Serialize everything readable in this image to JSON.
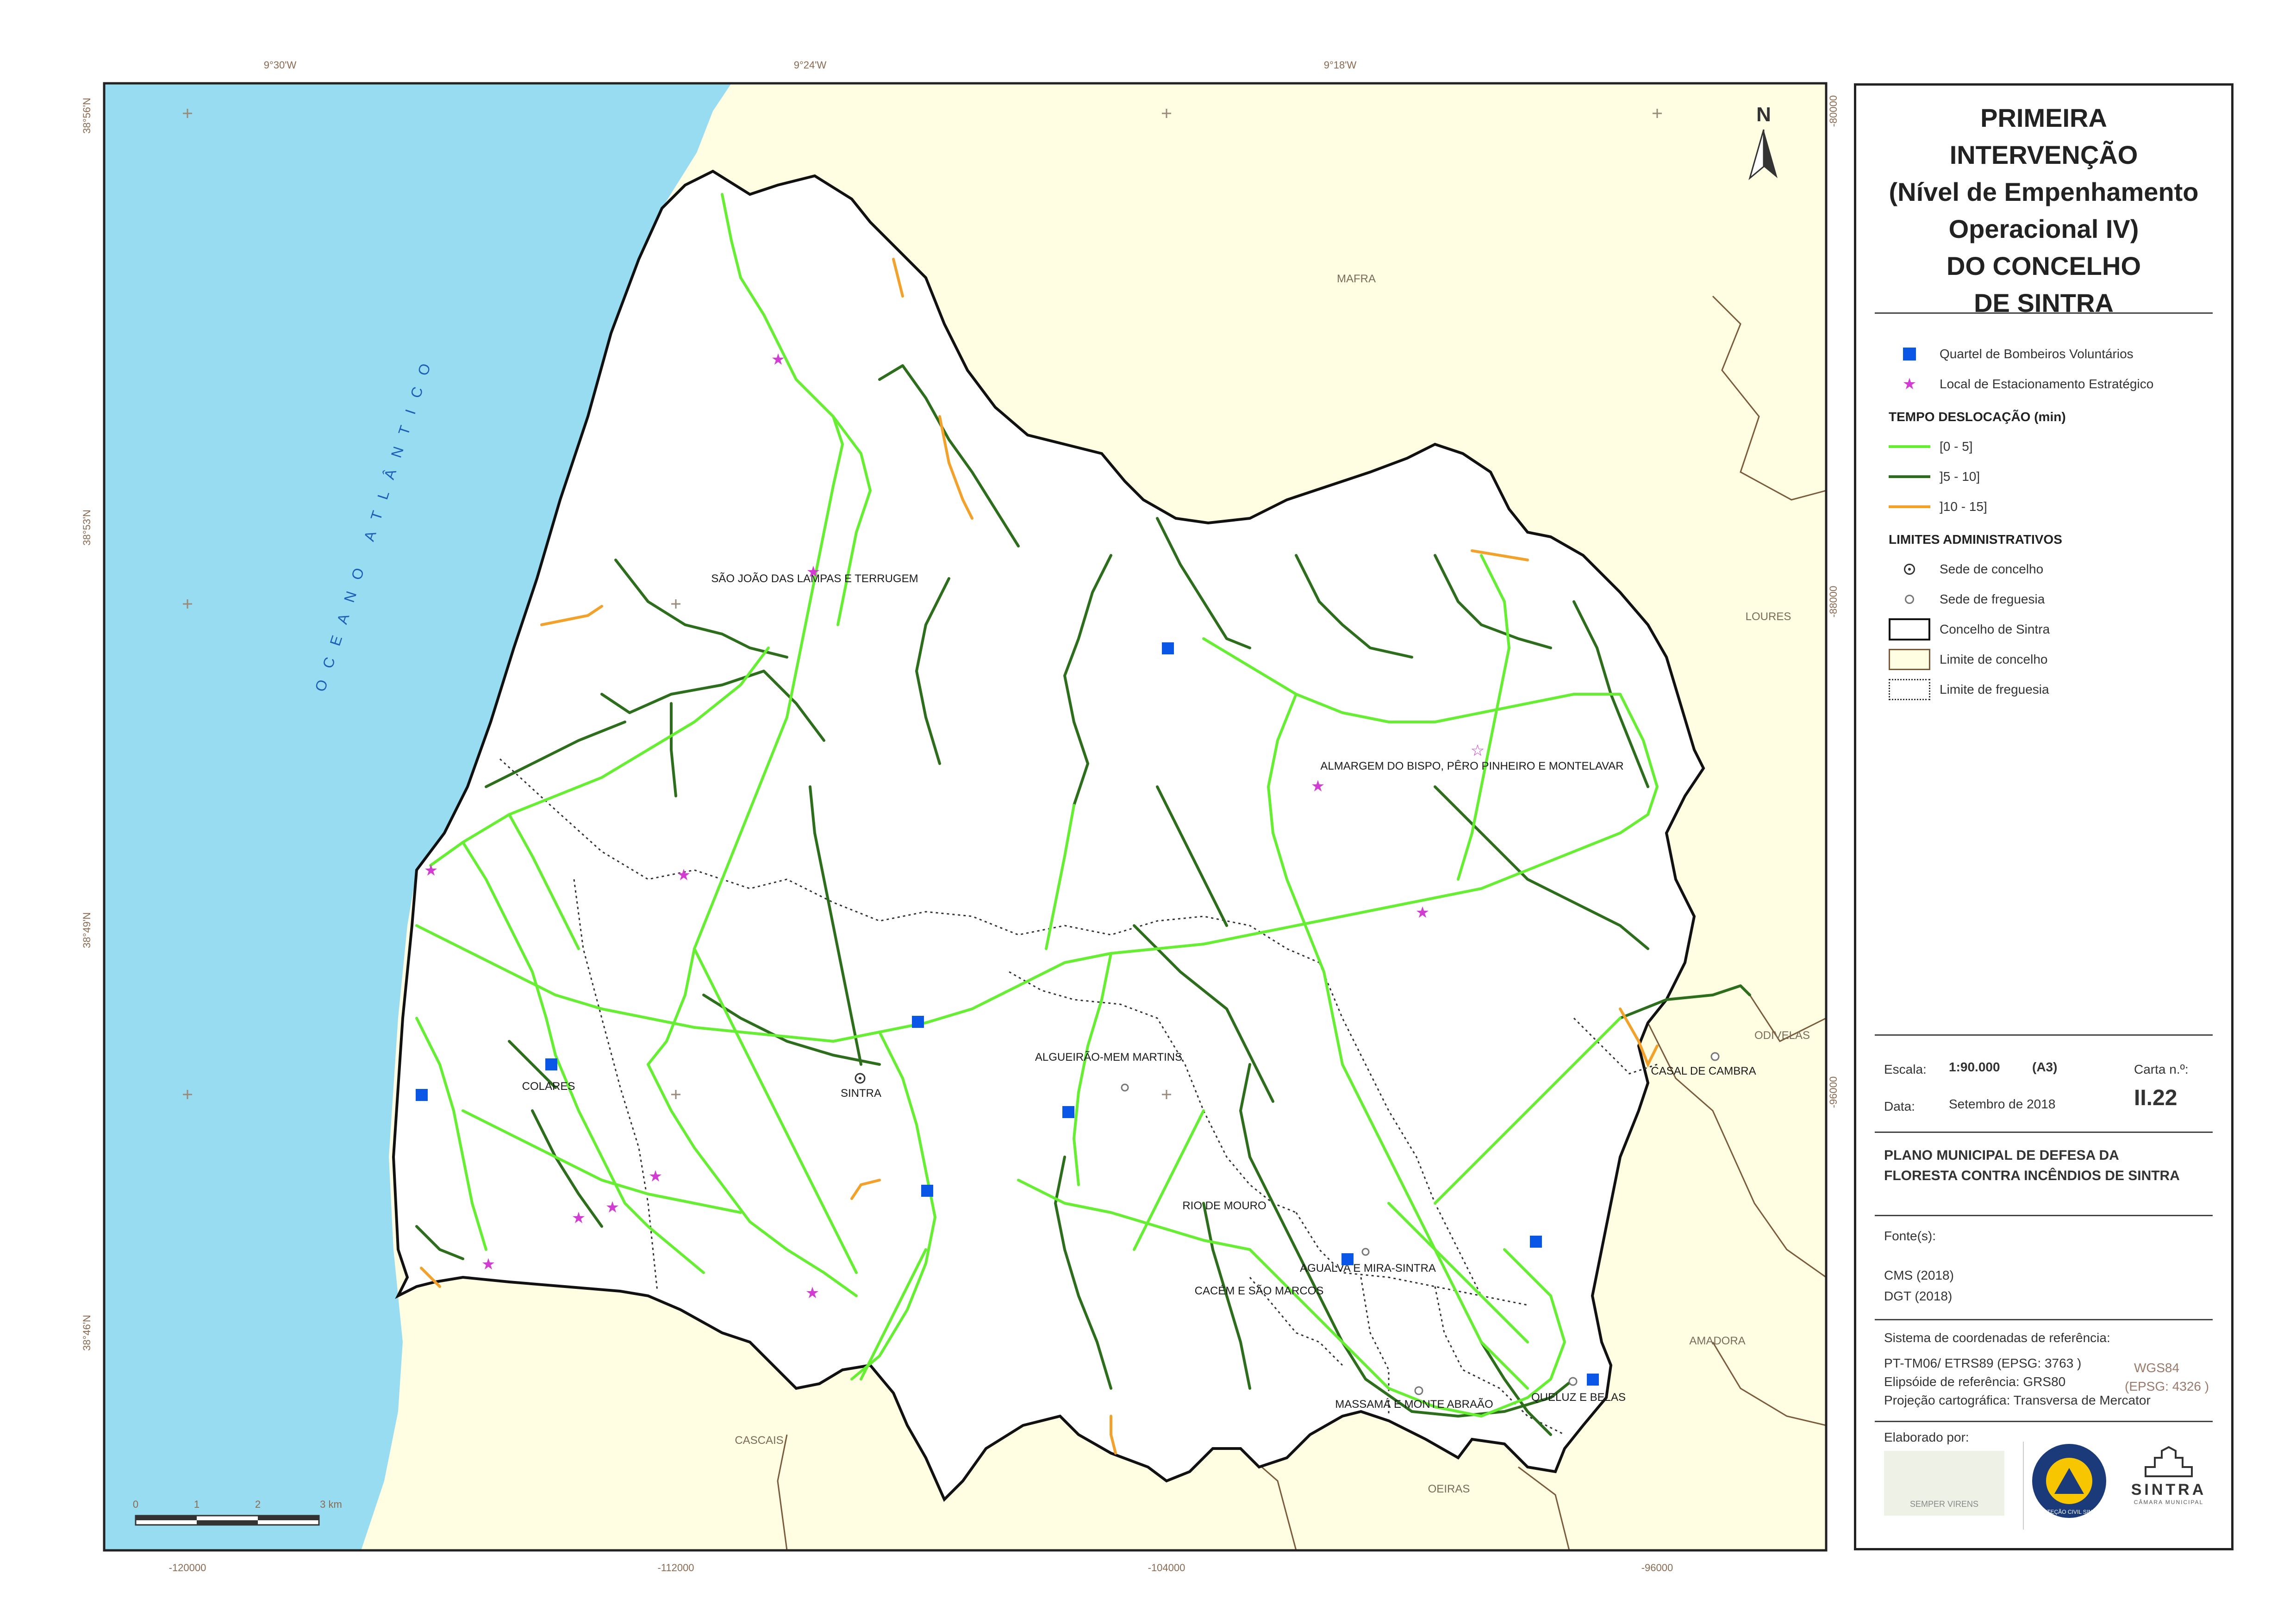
{
  "colors": {
    "ocean": "#98dcf2",
    "land": "#fffde2",
    "sintra_fill": "#ffffff",
    "class_0_5": "#66ee33",
    "class_5_10": "#2d6e1c",
    "class_10_15": "#f2a22a",
    "fire_station": "#0a56e6",
    "staging_point": "#d23cd2",
    "boundary_council": "#111111",
    "boundary_neighbor": "#7a5a3a"
  },
  "map": {
    "ocean_label": "OCEANO ATLÂNTICO",
    "lon_labels": [
      "9°30'W",
      "9°24'W",
      "9°18'W"
    ],
    "lat_labels": [
      "38°56'N",
      "38°53'N",
      "38°49'N",
      "38°46'N"
    ],
    "x_labels": [
      "-120000",
      "-112000",
      "-104000",
      "-96000"
    ],
    "y_labels": [
      "-80000",
      "-88000",
      "-96000"
    ],
    "north_label": "N",
    "neighbors": [
      "MAFRA",
      "LOURES",
      "ODIVELAS",
      "AMADORA",
      "OEIRAS",
      "CASCAIS"
    ],
    "parishes": [
      "SÃO JOÃO DAS LAMPAS E TERRUGEM",
      "ALMARGEM DO BISPO, PÊRO PINHEIRO E MONTELAVAR",
      "COLARES",
      "SINTRA",
      "ALGUEIRÃO-MEM MARTINS",
      "CASAL DE CAMBRA",
      "RIO DE MOURO",
      "AGUALVA E MIRA-SINTRA",
      "CACÉM E SÃO MARCOS",
      "MASSAMÁ E MONTE ABRAÃO",
      "QUELUZ E BELAS"
    ],
    "scale_bar": {
      "ticks": [
        "0",
        "1",
        "2",
        "3 km"
      ]
    }
  },
  "panel": {
    "title_lines": [
      "PRIMEIRA",
      "INTERVENÇÃO",
      "(Nível de Empenhamento",
      "Operacional  IV)",
      "DO CONCELHO",
      "DE SINTRA"
    ],
    "legend": {
      "fire_station": "Quartel de Bombeiros Voluntários",
      "staging": "Local de Estacionamento Estratégico",
      "time_heading": "TEMPO DESLOCAÇÃO (min)",
      "class_0_5": "[0 - 5]",
      "class_5_10": "]5 - 10]",
      "class_10_15": "]10 - 15]",
      "admin_heading": "LIMITES ADMINISTRATIVOS",
      "seat_council": "Sede de concelho",
      "seat_parish": "Sede de freguesia",
      "council": "Concelho de Sintra",
      "council_limit": "Limite de concelho",
      "parish_limit": "Limite de freguesia"
    },
    "info": {
      "scale_label": "Escala:",
      "scale_value": "1:90.000",
      "paper": "(A3)",
      "sheet_label": "Carta n.º:",
      "sheet_value": "II.22",
      "date_label": "Data:",
      "date_value": "Setembro de 2018",
      "plan_title": "PLANO MUNICIPAL DE DEFESA DA FLORESTA CONTRA INCÊNDIOS DE SINTRA",
      "sources_label": "Fonte(s):",
      "sources": [
        "CMS (2018)",
        "DGT (2018)"
      ],
      "crs_label": "Sistema de coordenadas de referência:",
      "crs_1": "PT-TM06/ ETRS89 (EPSG: 3763 )",
      "crs_2": "Elipsóide de referência: GRS80",
      "crs_3": "Projeção cartográfica: Transversa de Mercator",
      "wgs": "WGS84",
      "wgs_epsg": "(EPSG: 4326 )",
      "elaborated": "Elaborado por:",
      "logo1_text": "SEMPER VIRENS",
      "logo2_text": "PROTEÇÃO CIVIL SINTRA",
      "logo3_text": "SINTRA",
      "logo3_sub": "CÂMARA MUNICIPAL"
    }
  }
}
